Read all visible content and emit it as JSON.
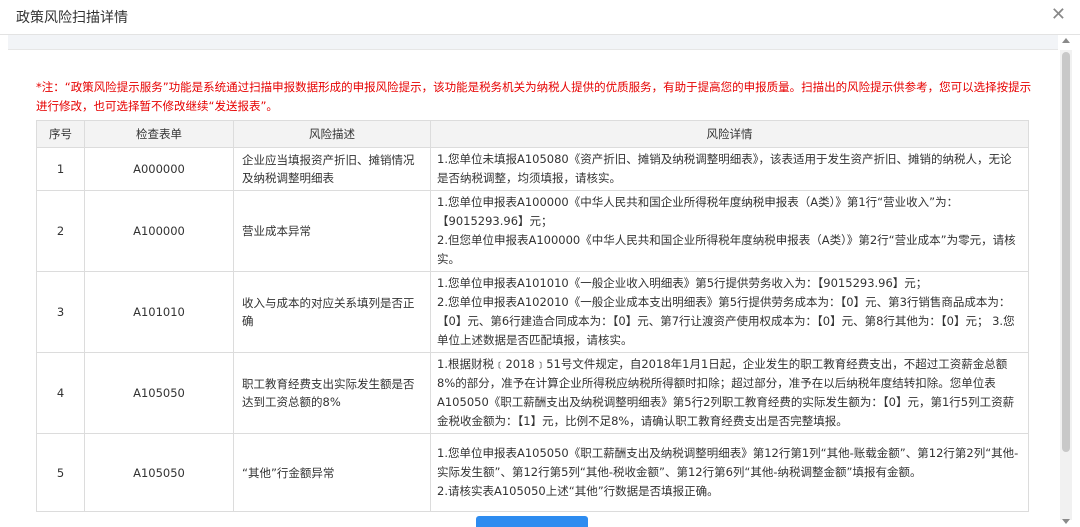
{
  "dialog": {
    "title": "政策风险扫描详情",
    "close_glyph": "✕"
  },
  "notice": "*注：“政策风险提示服务”功能是系统通过扫描申报数据形成的申报风险提示，该功能是税务机关为纳税人提供的优质服务，有助于提高您的申报质量。扫描出的风险提示供参考，您可以选择按提示进行修改，也可选择暂不修改继续“发送报表”。",
  "table": {
    "headers": [
      "序号",
      "检查表单",
      "风险描述",
      "风险详情"
    ],
    "rows": [
      {
        "no": "1",
        "form": "A000000",
        "desc": "企业应当填报资产折旧、摊销情况及纳税调整明细表",
        "detail": "1.您单位未填报A105080《资产折旧、摊销及纳税调整明细表》，该表适用于发生资产折旧、摊销的纳税人，无论是否纳税调整，均须填报，请核实。"
      },
      {
        "no": "2",
        "form": "A100000",
        "desc": "营业成本异常",
        "detail": "1.您单位申报表A100000《中华人民共和国企业所得税年度纳税申报表（A类）》第1行“营业收入”为：【9015293.96】元；\n2.但您单位申报表A100000《中华人民共和国企业所得税年度纳税申报表（A类）》第2行“营业成本”为零元，请核实。"
      },
      {
        "no": "3",
        "form": "A101010",
        "desc": "收入与成本的对应关系填列是否正确",
        "detail": "1.您单位申报表A101010《一般企业收入明细表》第5行提供劳务收入为：【9015293.96】元；\n2.您单位申报表A102010《一般企业成本支出明细表》第5行提供劳务成本为：【0】元、第3行销售商品成本为：【0】元、第6行建造合同成本为：【0】元、第7行让渡资产使用权成本为：【0】元、第8行其他为：【0】元； 3.您单位上述数据是否匹配填报，请核实。"
      },
      {
        "no": "4",
        "form": "A105050",
        "desc": "职工教育经费支出实际发生额是否达到工资总额的8%",
        "detail": "1.根据财税﹝2018﹞51号文件规定，自2018年1月1日起，企业发生的职工教育经费支出，不超过工资薪金总额8%的部分，准予在计算企业所得税应纳税所得额时扣除；超过部分，准予在以后纳税年度结转扣除。您单位表A105050《职工薪酬支出及纳税调整明细表》第5行2列职工教育经费的实际发生额为：【0】元，第1行5列工资薪金税收金额为：【1】元，比例不足8%，请确认职工教育经费支出是否完整填报。"
      },
      {
        "no": "5",
        "form": "A105050",
        "desc": "“其他”行金额异常",
        "detail": "1.您单位申报表A105050《职工薪酬支出及纳税调整明细表》第12行第1列“其他-账载金额”、第12行第2列“其他-实际发生额”、第12行第5列“其他-税收金额”、第12行第6列“其他-纳税调整金额”填报有金额。\n2.请核实表A105050上述“其他”行数据是否填报正确。"
      }
    ]
  },
  "colors": {
    "notice_red": "#e60000",
    "header_bg": "#f3f3f3",
    "accent_blue": "#2d8cf0"
  }
}
